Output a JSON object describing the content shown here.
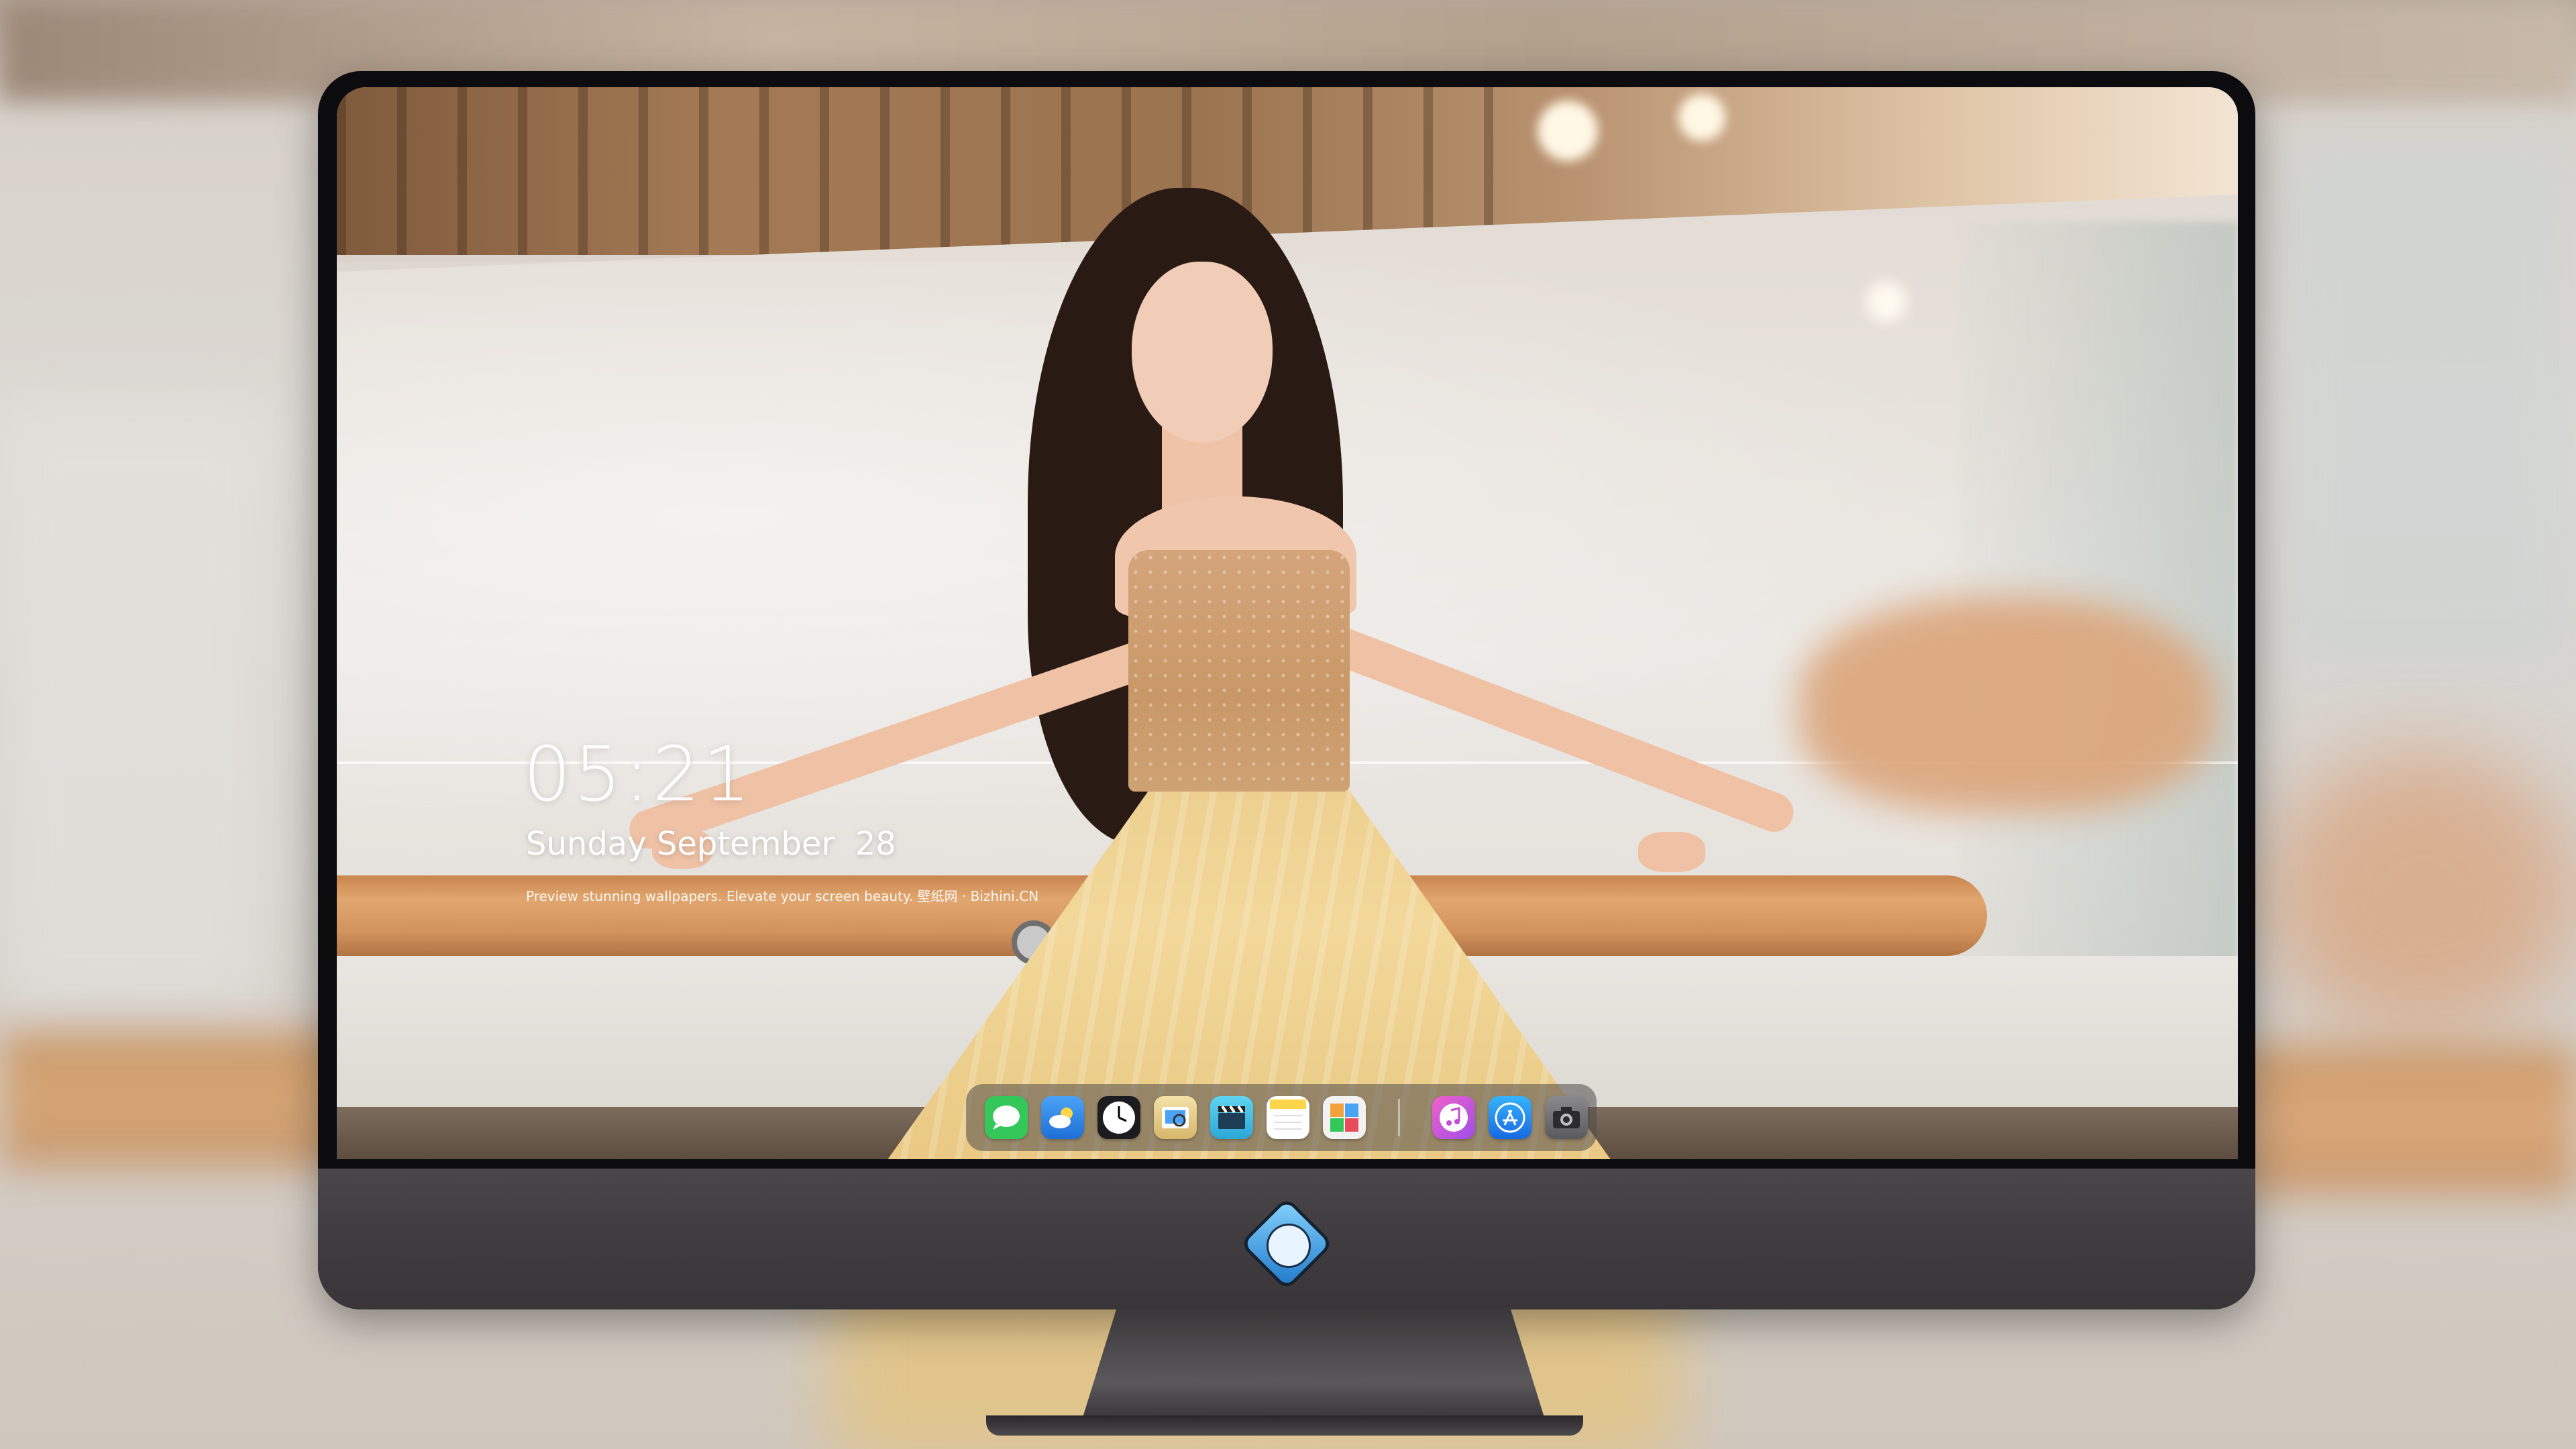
{
  "lock_screen": {
    "time": "05:21",
    "date": "Sunday September  28",
    "tagline": "Preview stunning wallpapers. Elevate your screen beauty. 壁纸网 · Bizhini.CN"
  },
  "dock": {
    "apps": [
      {
        "name": "Messages",
        "icon": "message-icon",
        "color": "#34c759"
      },
      {
        "name": "Weather",
        "icon": "weather-icon",
        "color": "#2d8cf0"
      },
      {
        "name": "Clock",
        "icon": "clock-icon",
        "color": "#1c1c1e"
      },
      {
        "name": "Preview",
        "icon": "preview-icon",
        "color": "#e8d39a"
      },
      {
        "name": "Clips",
        "icon": "clapper-icon",
        "color": "#3fc3e8"
      },
      {
        "name": "Notes",
        "icon": "notes-icon",
        "color": "#ffd54a"
      },
      {
        "name": "Photo Booth",
        "icon": "photos-icon",
        "color": "#f2f2f2"
      },
      {
        "name": "Music",
        "icon": "music-icon",
        "color": "#d24bd8"
      },
      {
        "name": "App Store",
        "icon": "appstore-icon",
        "color": "#1d8ef5"
      },
      {
        "name": "Camera",
        "icon": "camera-icon",
        "color": "#6b6b6d"
      }
    ]
  },
  "colors": {
    "monitor_bezel": "#0c0c0e",
    "monitor_chin": "#423e42",
    "dock_bg": "rgba(80,76,74,.55)",
    "rail": "#d89a63",
    "dress": "#f0d494"
  }
}
